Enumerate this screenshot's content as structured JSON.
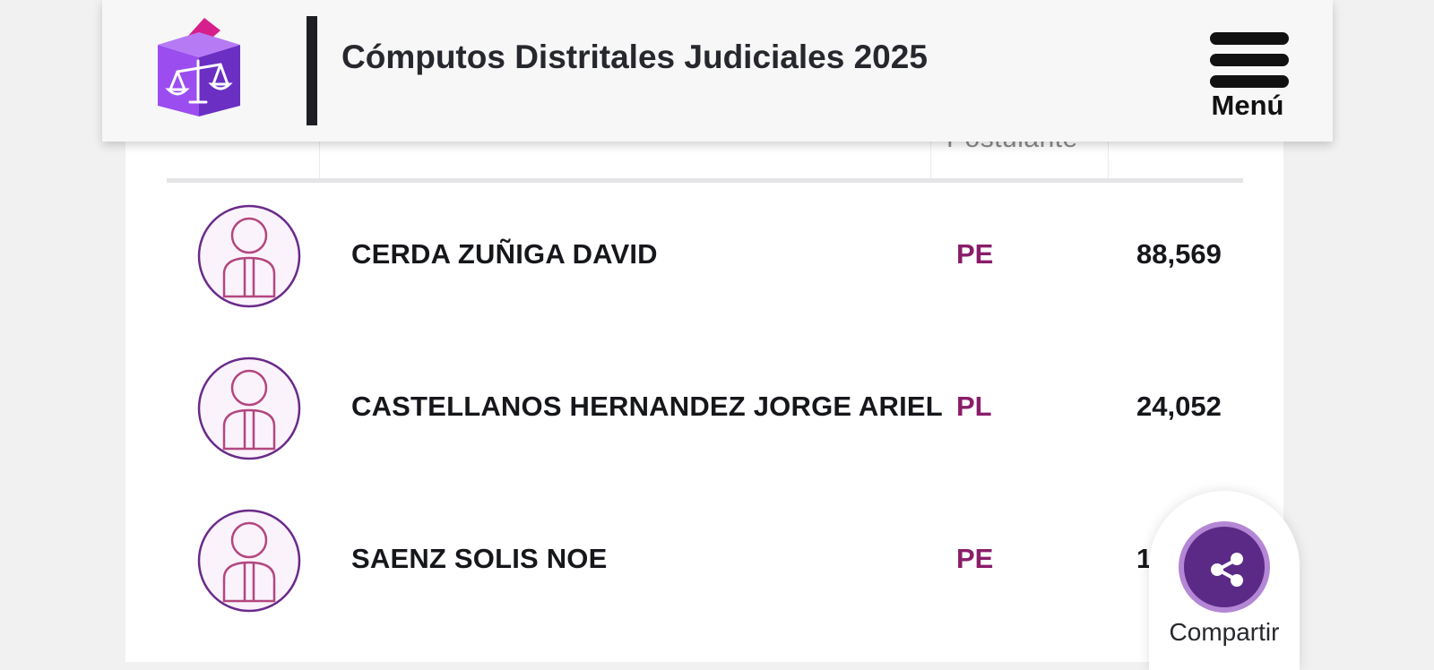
{
  "header": {
    "title": "Cómputos Distritales Judiciales 2025",
    "menu_label": "Menú",
    "logo_icon": "ballot-box-scales-icon",
    "menu_icon": "hamburger-icon"
  },
  "table": {
    "partial_column_header": "Postulante",
    "rows": [
      {
        "name": "CERDA ZUÑIGA DAVID",
        "type": "PE",
        "votes": "88,569",
        "icon": "person-icon"
      },
      {
        "name": "CASTELLANOS HERNANDEZ JORGE ARIEL",
        "type": "PL",
        "votes": "24,052",
        "icon": "person-icon"
      },
      {
        "name": "SAENZ SOLIS NOE",
        "type": "PE",
        "votes": "1",
        "icon": "person-icon"
      }
    ]
  },
  "share": {
    "label": "Compartir",
    "icon": "share-icon"
  },
  "colors": {
    "accent_purple": "#5a2a86",
    "type_magenta": "#8a1d6b",
    "avatar_outline": "#6a2a8a",
    "avatar_fill": "#fbf3fb"
  }
}
